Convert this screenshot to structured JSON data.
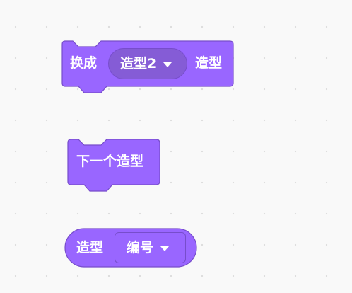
{
  "colors": {
    "block_fill": "#9966ff",
    "block_stroke": "#774dcb",
    "dropdown_fill": "#855cd6",
    "reporter_dropdown_fill": "#9966ff",
    "text": "#ffffff",
    "canvas": "#f9f9f9"
  },
  "blocks": {
    "switch_costume": {
      "prefix": "换成",
      "menu_value": "造型2",
      "suffix": "造型",
      "menu_icon": "caret-down-icon"
    },
    "next_costume": {
      "label": "下一个造型"
    },
    "costume_reporter": {
      "prefix": "造型",
      "menu_value": "编号",
      "menu_icon": "caret-down-icon"
    }
  }
}
